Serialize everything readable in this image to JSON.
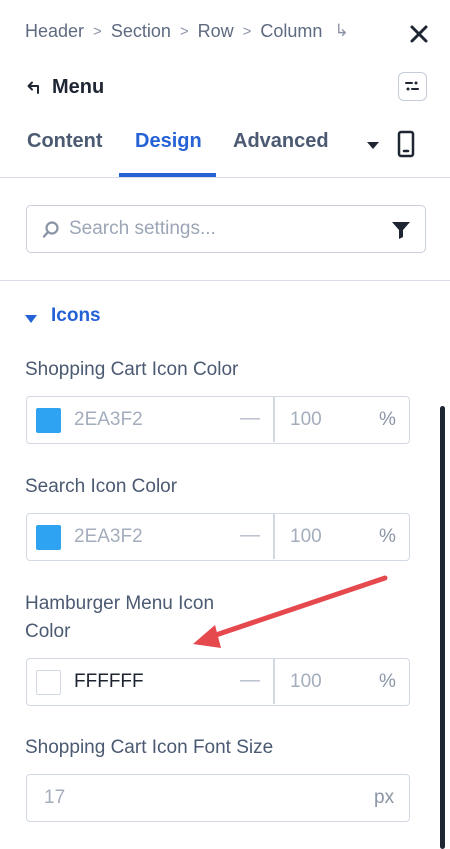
{
  "breadcrumb": {
    "items": [
      "Header",
      "Section",
      "Row",
      "Column"
    ],
    "enter_glyph": "↳"
  },
  "header": {
    "title": "Menu",
    "close_icon": "close-icon",
    "back_icon": "back-arrow-icon",
    "layout_icon": "layout-toggle-icon"
  },
  "tabs": [
    {
      "label": "Content",
      "active": false
    },
    {
      "label": "Design",
      "active": true
    },
    {
      "label": "Advanced",
      "active": false
    }
  ],
  "tab_extra": {
    "dropdown_icon": "caret-down-icon",
    "device_icon": "mobile-device-icon"
  },
  "search": {
    "placeholder": "Search settings...",
    "value": "",
    "filter_icon": "filter-icon"
  },
  "section": {
    "label": "Icons",
    "expanded": true
  },
  "fields": {
    "cart_color": {
      "label": "Shopping Cart Icon Color",
      "hex": "2EA3F2",
      "swatch_color": "#2EA3F2",
      "alpha": "100",
      "alpha_unit": "%",
      "dash": "—"
    },
    "search_color": {
      "label": "Search Icon Color",
      "hex": "2EA3F2",
      "swatch_color": "#2EA3F2",
      "alpha": "100",
      "alpha_unit": "%",
      "dash": "—"
    },
    "hamburger_color": {
      "label_line1": "Hamburger Menu Icon",
      "label_line2": "Color",
      "hex": "FFFFFF",
      "swatch_color": "#FFFFFF",
      "alpha": "100",
      "alpha_unit": "%",
      "dash": "—"
    },
    "cart_font_size": {
      "label": "Shopping Cart Icon Font Size",
      "value": "17",
      "unit": "px"
    }
  },
  "colors": {
    "accent": "#2562D6",
    "annotation_arrow": "#E5484D"
  }
}
